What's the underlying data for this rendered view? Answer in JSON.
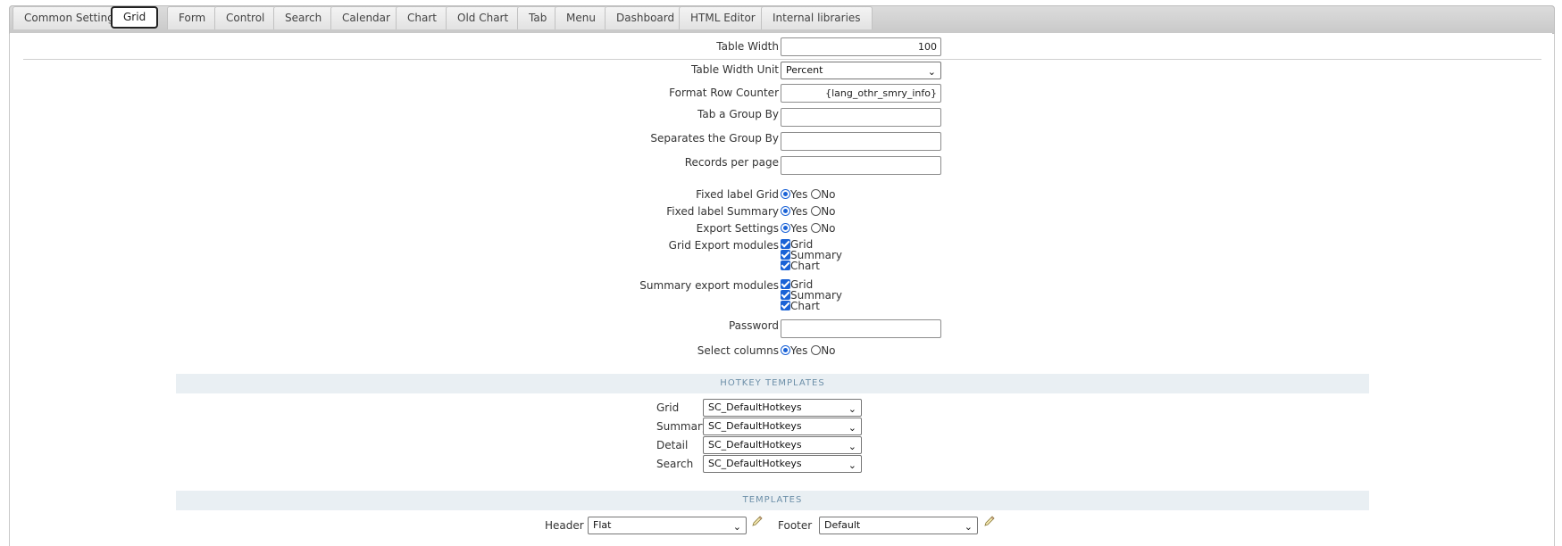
{
  "tabs": [
    {
      "label": "Common Settings",
      "active": false
    },
    {
      "label": "Grid",
      "active": true
    },
    {
      "label": "Form",
      "active": false
    },
    {
      "label": "Control",
      "active": false
    },
    {
      "label": "Search",
      "active": false
    },
    {
      "label": "Calendar",
      "active": false
    },
    {
      "label": "Chart",
      "active": false
    },
    {
      "label": "Old Chart",
      "active": false
    },
    {
      "label": "Tab",
      "active": false
    },
    {
      "label": "Menu",
      "active": false
    },
    {
      "label": "Dashboard",
      "active": false
    },
    {
      "label": "HTML Editor",
      "active": false
    },
    {
      "label": "Internal libraries",
      "active": false
    }
  ],
  "form": {
    "table_width": {
      "label": "Table Width",
      "value": "100"
    },
    "table_width_unit": {
      "label": "Table Width Unit",
      "value": "Percent"
    },
    "format_row_counter": {
      "label": "Format Row Counter",
      "value": "{lang_othr_smry_info}"
    },
    "tab_group_by": {
      "label": "Tab a Group By",
      "value": ""
    },
    "separates_group_by": {
      "label": "Separates the Group By",
      "value": ""
    },
    "records_per_page": {
      "label": "Records per page",
      "value": ""
    },
    "fixed_label_grid": {
      "label": "Fixed label Grid",
      "yes": "Yes",
      "no": "No",
      "selected": "Yes"
    },
    "fixed_label_summary": {
      "label": "Fixed label Summary",
      "yes": "Yes",
      "no": "No",
      "selected": "Yes"
    },
    "export_settings": {
      "label": "Export Settings",
      "yes": "Yes",
      "no": "No",
      "selected": "Yes"
    },
    "grid_export_modules": {
      "label": "Grid Export modules",
      "options": [
        "Grid",
        "Summary",
        "Chart"
      ]
    },
    "summary_export_modules": {
      "label": "Summary export modules",
      "options": [
        "Grid",
        "Summary",
        "Chart"
      ]
    },
    "password": {
      "label": "Password",
      "value": ""
    },
    "select_columns": {
      "label": "Select columns",
      "yes": "Yes",
      "no": "No",
      "selected": "Yes"
    }
  },
  "hotkey_templates": {
    "title": "HOTKEY TEMPLATES",
    "rows": [
      {
        "label": "Grid",
        "value": "SC_DefaultHotkeys"
      },
      {
        "label": "Summary",
        "value": "SC_DefaultHotkeys"
      },
      {
        "label": "Detail",
        "value": "SC_DefaultHotkeys"
      },
      {
        "label": "Search",
        "value": "SC_DefaultHotkeys"
      }
    ]
  },
  "templates": {
    "title": "TEMPLATES",
    "header_label": "Header",
    "header_value": "Flat",
    "footer_label": "Footer",
    "footer_value": "Default"
  },
  "icons": {
    "select_arrow": "chevron-down-icon",
    "edit": "pencil-icon"
  },
  "colors": {
    "accent": "#1a62d6",
    "section_bg": "#e9eff3",
    "section_text": "#6c8fa8"
  }
}
